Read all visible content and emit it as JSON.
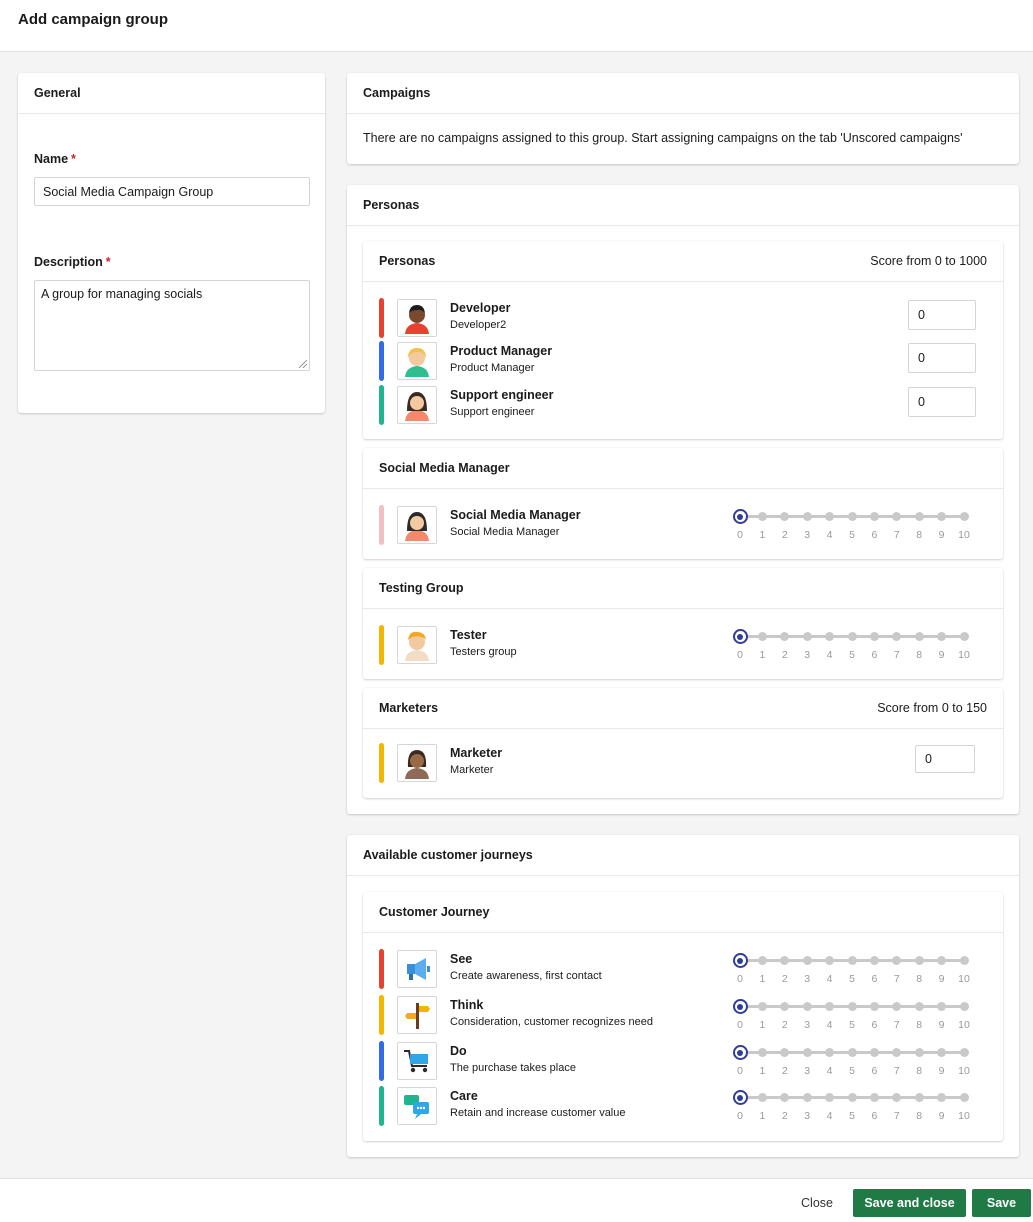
{
  "page": {
    "title": "Add campaign group"
  },
  "general": {
    "header": "General",
    "name_label": "Name",
    "name_value": "Social Media Campaign Group",
    "description_label": "Description",
    "description_value": "A group for managing socials",
    "required_mark": "*"
  },
  "campaigns": {
    "header": "Campaigns",
    "message": "There are no campaigns assigned to this group. Start assigning campaigns on the tab 'Unscored campaigns'"
  },
  "personas": {
    "header": "Personas",
    "groups": [
      {
        "title": "Personas",
        "score_range": "Score from 0 to 1000",
        "items": [
          {
            "name": "Developer",
            "sub": "Developer2",
            "value": "0",
            "color": "#e8412f",
            "icon": "developer-avatar-icon"
          },
          {
            "name": "Product Manager",
            "sub": "Product Manager",
            "value": "0",
            "color": "#2f6de8",
            "icon": "product-manager-avatar-icon"
          },
          {
            "name": "Support engineer",
            "sub": "Support engineer",
            "value": "0",
            "color": "#1fb58f",
            "icon": "support-engineer-avatar-icon"
          }
        ]
      },
      {
        "title": "Social Media Manager",
        "items": [
          {
            "name": "Social Media Manager",
            "sub": "Social Media Manager",
            "slider_value": 0,
            "color": "#f3c0bf",
            "icon": "social-media-manager-avatar-icon"
          }
        ]
      },
      {
        "title": "Testing Group",
        "items": [
          {
            "name": "Tester",
            "sub": "Testers group",
            "slider_value": 0,
            "color": "#f5b400",
            "icon": "tester-avatar-icon"
          }
        ]
      },
      {
        "title": "Marketers",
        "score_range": "Score from 0 to 150",
        "items": [
          {
            "name": "Marketer",
            "sub": "Marketer",
            "value": "0",
            "color": "#f5b400",
            "icon": "marketer-avatar-icon"
          }
        ]
      }
    ]
  },
  "journeys": {
    "header": "Available customer journeys",
    "group_title": "Customer Journey",
    "items": [
      {
        "name": "See",
        "sub": "Create awareness, first contact",
        "slider_value": 0,
        "color": "#e8412f",
        "icon": "megaphone-icon"
      },
      {
        "name": "Think",
        "sub": "Consideration, customer recognizes need",
        "slider_value": 0,
        "color": "#f5b400",
        "icon": "signpost-icon"
      },
      {
        "name": "Do",
        "sub": "The purchase takes place",
        "slider_value": 0,
        "color": "#2f6de8",
        "icon": "shopping-cart-icon"
      },
      {
        "name": "Care",
        "sub": "Retain and increase customer value",
        "slider_value": 0,
        "color": "#1fb58f",
        "icon": "chat-bubbles-icon"
      }
    ]
  },
  "slider": {
    "min": 0,
    "max": 10,
    "labels": [
      "0",
      "1",
      "2",
      "3",
      "4",
      "5",
      "6",
      "7",
      "8",
      "9",
      "10"
    ]
  },
  "footer": {
    "close_label": "Close",
    "save_close_label": "Save and close",
    "save_label": "Save"
  },
  "colors": {
    "primary_button": "#1f7a46",
    "slider_knob": "#2f3d9a",
    "required": "#c4262e"
  }
}
